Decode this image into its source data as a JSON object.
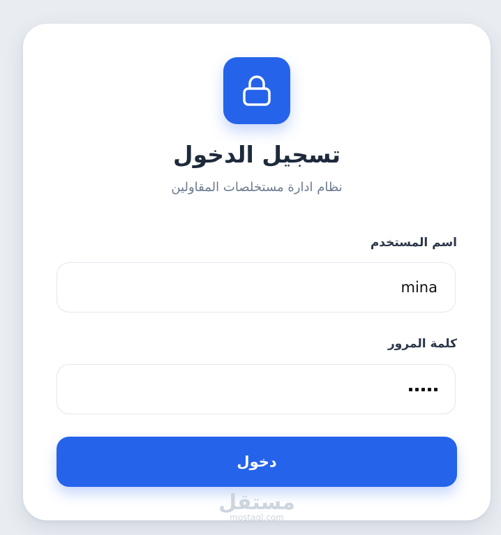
{
  "header": {
    "icon": "lock-icon",
    "title": "تسجيل الدخول",
    "subtitle": "نظام ادارة مستخلصات المقاولين"
  },
  "form": {
    "username_label": "اسم المستخدم",
    "username_value": "mina",
    "password_label": "كلمة المرور",
    "password_value": "•••••",
    "submit_label": "دخول"
  },
  "watermark": {
    "arabic": "مستقل",
    "latin": "mostaql.com"
  },
  "colors": {
    "primary": "#2563eb",
    "background": "#e9edf2",
    "card": "#ffffff",
    "title": "#1e2a3b",
    "muted": "#6b7a8f"
  }
}
